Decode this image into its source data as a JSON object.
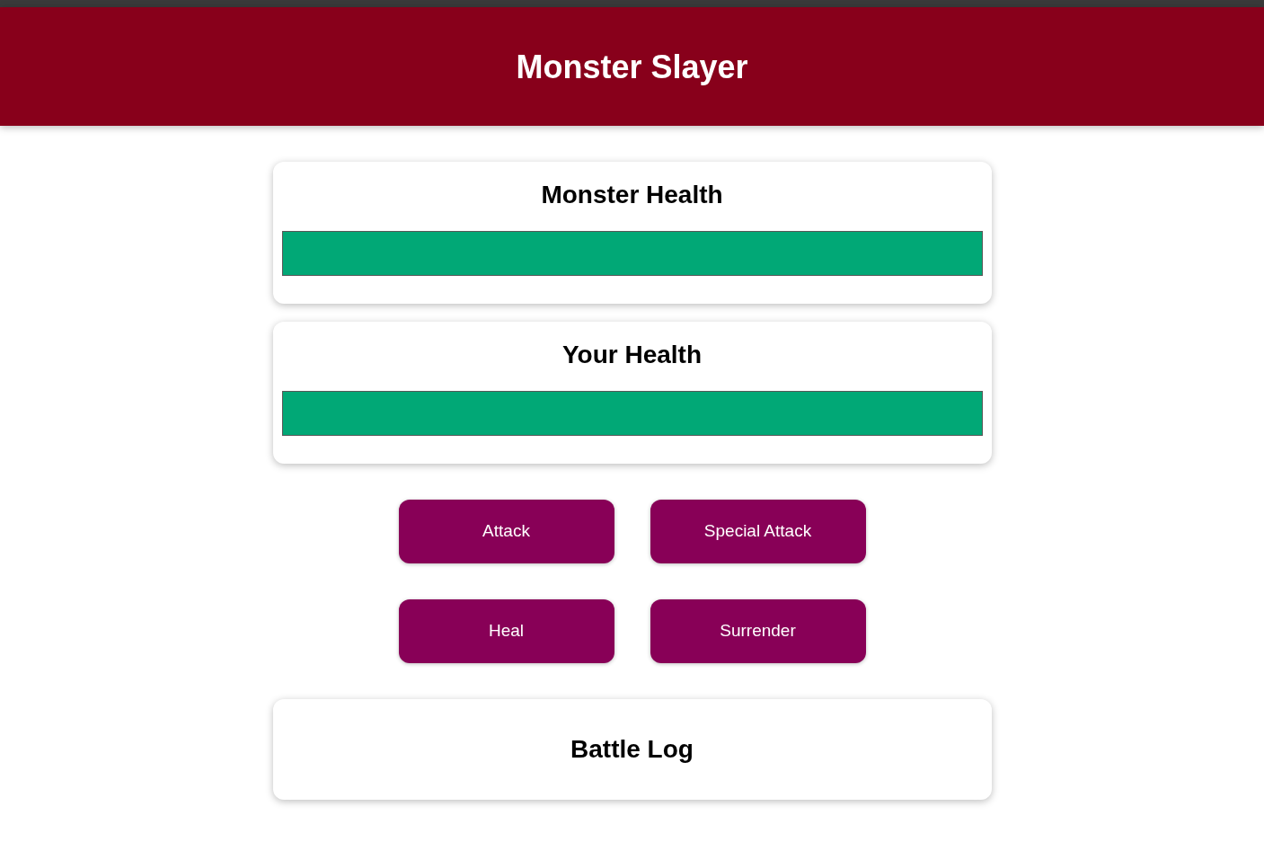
{
  "header": {
    "title": "Monster Slayer"
  },
  "health_bars": [
    {
      "title": "Monster Health",
      "level": 1
    },
    {
      "title": "Your Health",
      "level": 1
    }
  ],
  "controls": [
    {
      "label": "Attack"
    },
    {
      "label": "Special Attack"
    },
    {
      "label": "Heal"
    },
    {
      "label": "Surrender"
    }
  ],
  "battle_log": {
    "title": "Battle Log"
  }
}
